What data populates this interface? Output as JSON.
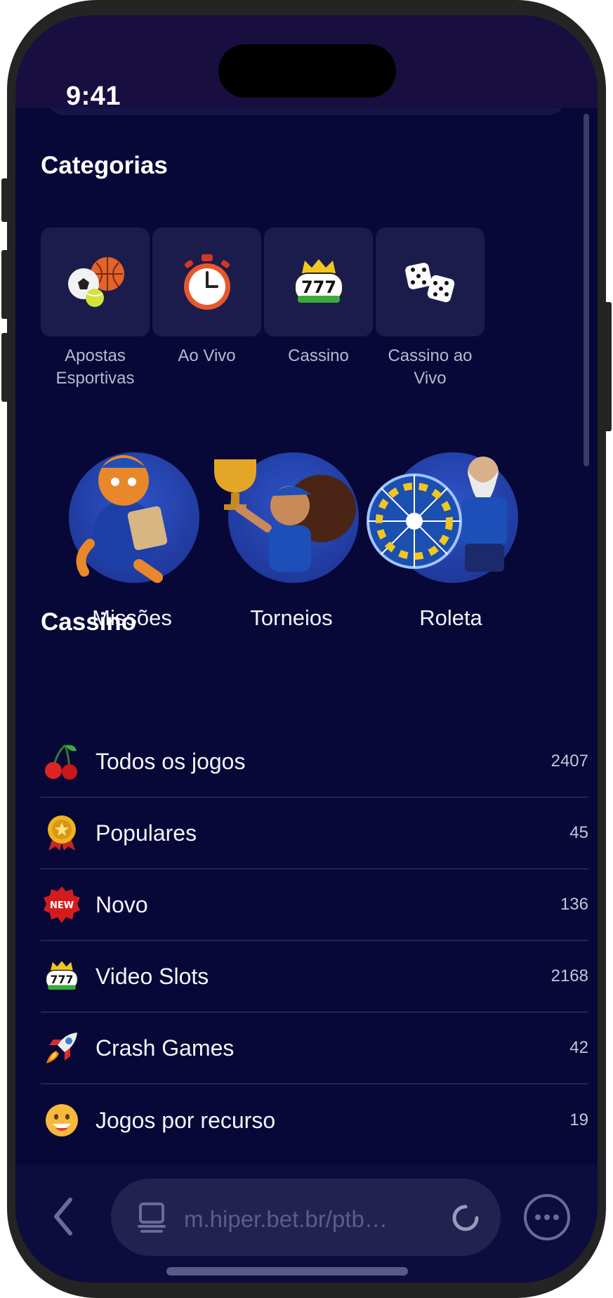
{
  "status": {
    "time": "9:41"
  },
  "categories": {
    "title": "Categorias",
    "items": [
      {
        "label": "Apostas Esportivas",
        "icon": "sports-balls-icon"
      },
      {
        "label": "Ao Vivo",
        "icon": "stopwatch-icon"
      },
      {
        "label": "Cassino",
        "icon": "slot-777-icon"
      },
      {
        "label": "Cassino ao Vivo",
        "icon": "dice-icon"
      }
    ]
  },
  "promos": [
    {
      "label": "Missões",
      "icon": "tiger-mascot-icon"
    },
    {
      "label": "Torneios",
      "icon": "trophy-girl-icon"
    },
    {
      "label": "Roleta",
      "icon": "roulette-wheel-icon"
    }
  ],
  "casino": {
    "title": "Cassino",
    "items": [
      {
        "label": "Todos os jogos",
        "count": "2407",
        "icon": "cherry-icon"
      },
      {
        "label": "Populares",
        "count": "45",
        "icon": "medal-icon"
      },
      {
        "label": "Novo",
        "count": "136",
        "icon": "new-badge-icon"
      },
      {
        "label": "Video Slots",
        "count": "2168",
        "icon": "slot-777-icon"
      },
      {
        "label": "Crash Games",
        "count": "42",
        "icon": "rocket-icon"
      },
      {
        "label": "Jogos por recurso",
        "count": "19",
        "icon": "emoji-icon"
      }
    ]
  },
  "browser": {
    "url": "m.hiper.bet.br/ptb…"
  },
  "colors": {
    "background": "#070738",
    "tile": "#1c1c4c",
    "accent": "#2d54c8"
  }
}
